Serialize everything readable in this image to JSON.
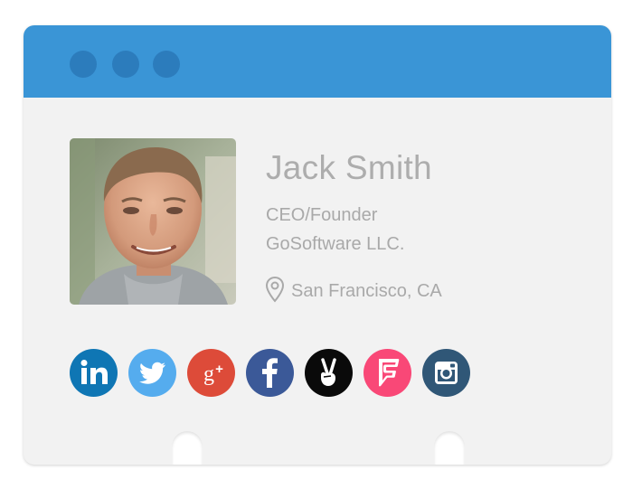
{
  "window": {
    "titlebar_color": "#3a95d6",
    "dots": [
      "window-dot",
      "window-dot",
      "window-dot"
    ]
  },
  "profile": {
    "photo_icon": "profile-photo",
    "name": "Jack Smith",
    "role": "CEO/Founder",
    "company": "GoSoftware LLC.",
    "location": "San Francisco, CA",
    "location_icon": "map-pin-icon"
  },
  "socials": [
    {
      "name": "linkedin-icon",
      "color": "#0f76b4",
      "glyph": "in"
    },
    {
      "name": "twitter-icon",
      "color": "#55acee",
      "glyph": "bird"
    },
    {
      "name": "google-plus-icon",
      "color": "#dd4b39",
      "glyph": "g+"
    },
    {
      "name": "facebook-icon",
      "color": "#3b5998",
      "glyph": "f"
    },
    {
      "name": "angellist-icon",
      "color": "#0a0a0a",
      "glyph": "peace"
    },
    {
      "name": "foursquare-icon",
      "color": "#f94877",
      "glyph": "fsq"
    },
    {
      "name": "instagram-icon",
      "color": "#305777",
      "glyph": "camera"
    }
  ]
}
